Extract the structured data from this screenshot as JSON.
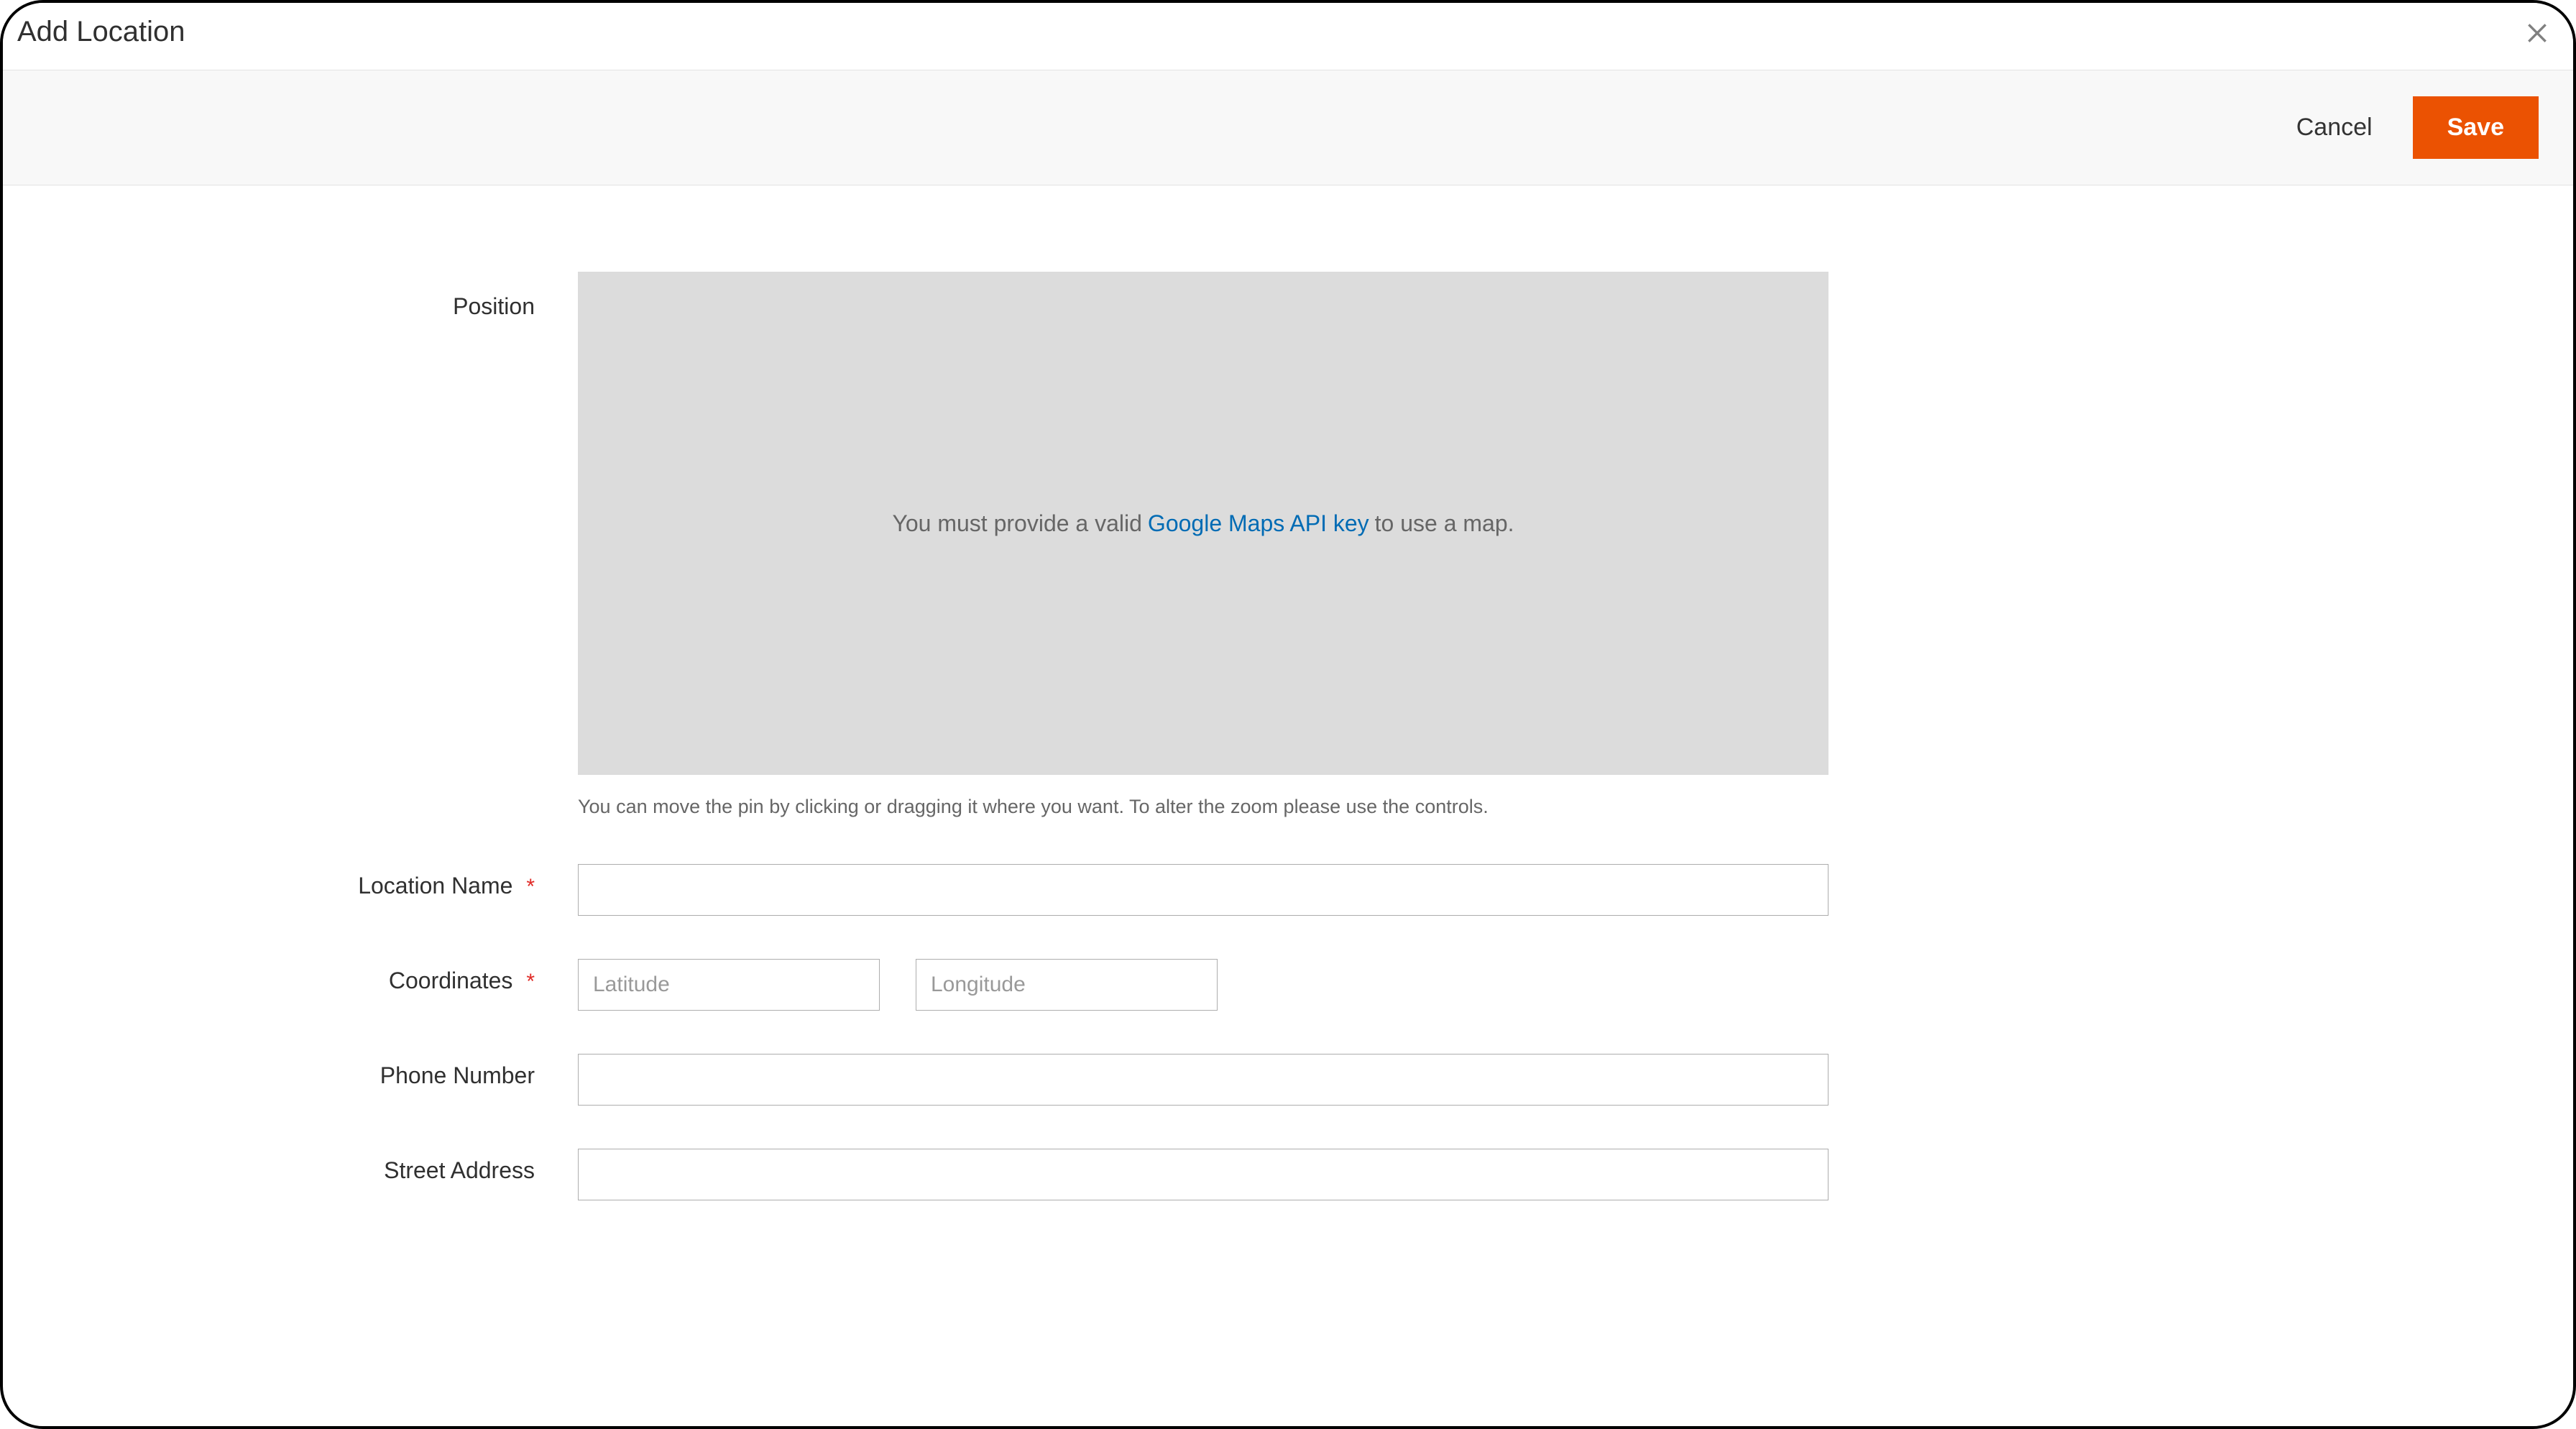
{
  "header": {
    "title": "Add Location"
  },
  "actions": {
    "cancel_label": "Cancel",
    "save_label": "Save"
  },
  "form": {
    "position": {
      "label": "Position",
      "map_msg_prefix": "You must provide a valid ",
      "map_link_text": "Google Maps API key",
      "map_msg_suffix": " to use a map.",
      "hint": "You can move the pin by clicking or dragging it where you want. To alter the zoom please use the controls."
    },
    "location_name": {
      "label": "Location Name",
      "value": ""
    },
    "coordinates": {
      "label": "Coordinates",
      "lat_placeholder": "Latitude",
      "lng_placeholder": "Longitude",
      "lat_value": "",
      "lng_value": ""
    },
    "phone": {
      "label": "Phone Number",
      "value": ""
    },
    "street": {
      "label": "Street Address",
      "value": ""
    }
  }
}
